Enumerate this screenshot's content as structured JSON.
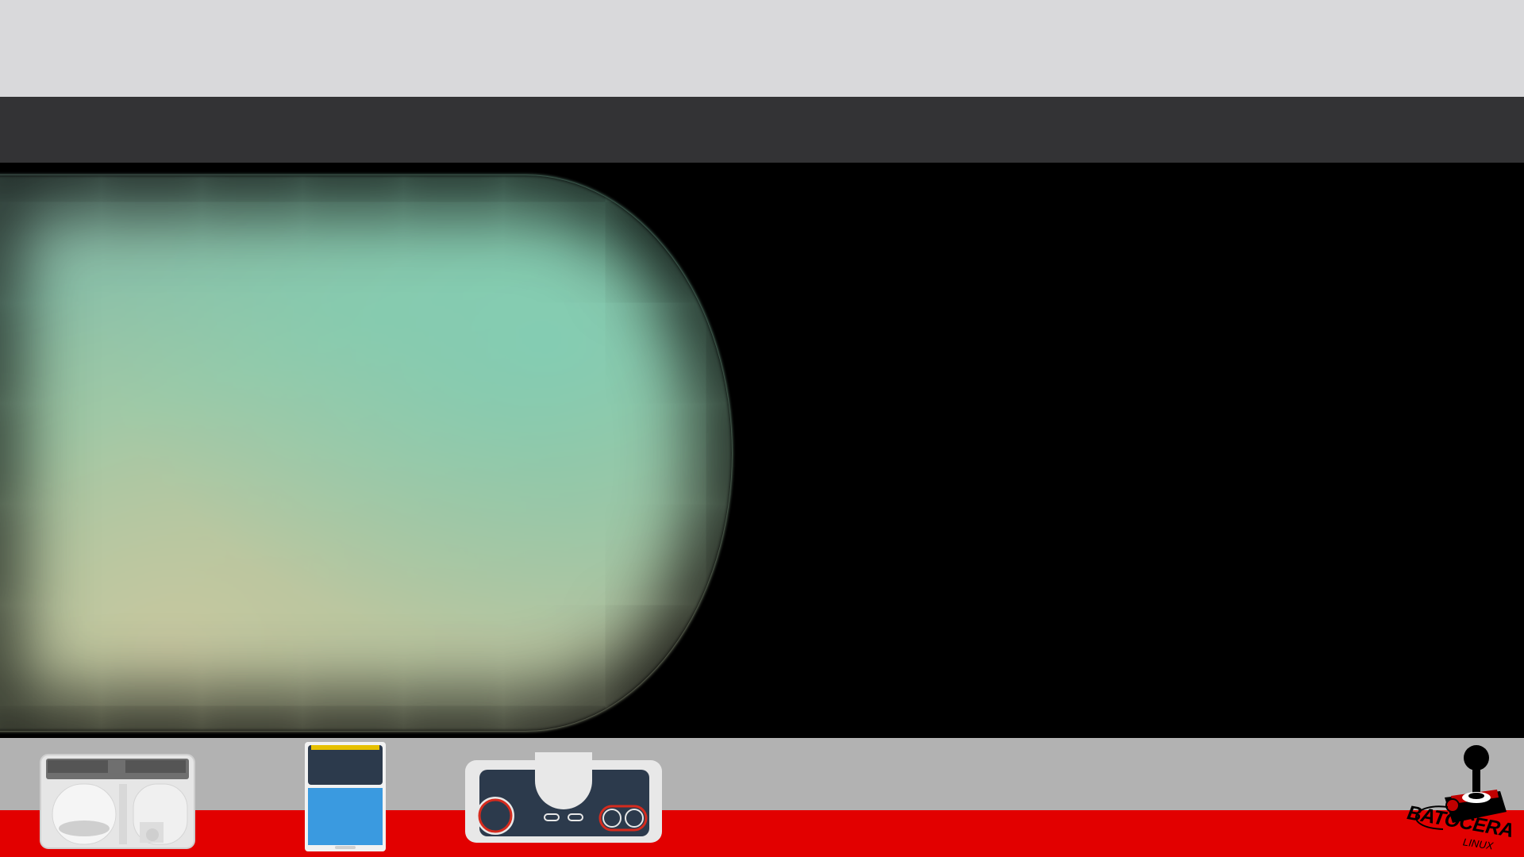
{
  "theme": {
    "top_band_color": "#d9d9db",
    "title_band_color": "#333335",
    "bottom_grey_color": "#b2b2b2",
    "bottom_red_color": "#e20000"
  },
  "game_view": {
    "video_state": "blurred-screen-preview"
  },
  "bottom_bar": {
    "icons": [
      "console-icon",
      "hucard-icon",
      "controller-icon"
    ]
  },
  "logo": {
    "name": "BATOCERA",
    "subtitle": "LINUX",
    "icon": "joystick-icon"
  }
}
